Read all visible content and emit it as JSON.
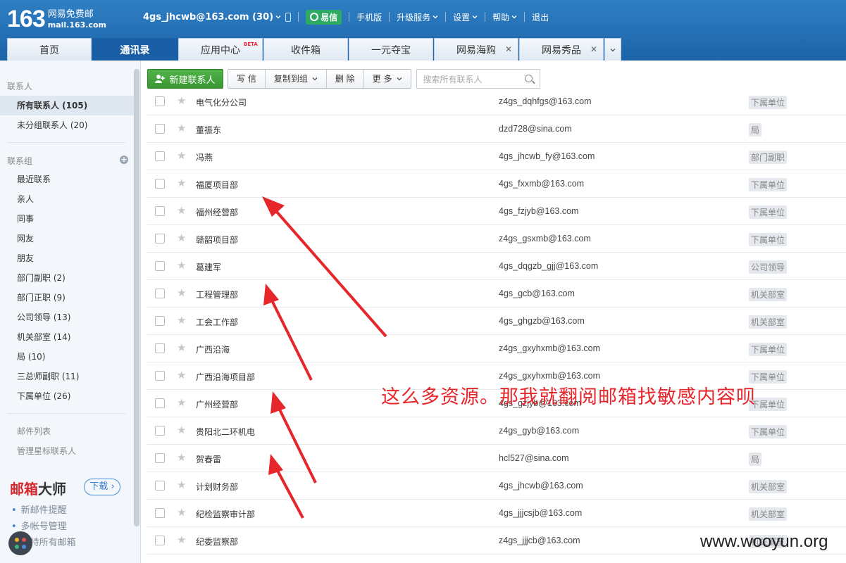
{
  "logo": {
    "number": "163",
    "line1": "网易免费邮",
    "line2": "mail.163.com"
  },
  "topbar": {
    "account": "4gs_jhcwb@163.com (30)",
    "yixin": "易信",
    "mobile": "手机版",
    "upgrade": "升级服务",
    "settings": "设置",
    "help": "帮助",
    "logout": "退出"
  },
  "tabs": [
    {
      "label": "首页"
    },
    {
      "label": "通讯录"
    },
    {
      "label": "应用中心",
      "badge": "BETA"
    },
    {
      "label": "收件箱"
    },
    {
      "label": "一元夺宝"
    },
    {
      "label": "网易海购"
    },
    {
      "label": "网易秀品"
    }
  ],
  "sidebar": {
    "contacts_head": "联系人",
    "all_contacts": "所有联系人 (105)",
    "ungrouped": "未分组联系人 (20)",
    "groups_head": "联系组",
    "groups": [
      "最近联系",
      "亲人",
      "同事",
      "网友",
      "朋友",
      "部门副职 (2)",
      "部门正职 (9)",
      "公司领导 (13)",
      "机关部室 (14)",
      "局 (10)",
      "三总师副职 (11)",
      "下属单位 (26)"
    ],
    "mail_list": "邮件列表",
    "manage_star": "管理星标联系人",
    "promo_title_red": "邮箱",
    "promo_title_dark": "大师",
    "download": "下载",
    "promo_items": [
      "新邮件提醒",
      "多帐号管理",
      "支持所有邮箱"
    ]
  },
  "toolbar": {
    "new_contact": "新建联系人",
    "write": "写 信",
    "copy_to_group": "复制到组",
    "delete": "删 除",
    "more": "更 多",
    "search_placeholder": "搜索所有联系人"
  },
  "contacts": [
    {
      "name": "电气化分公司",
      "email": "z4gs_dqhfgs@163.com",
      "tag": "下属单位"
    },
    {
      "name": "董振东",
      "email": "dzd728@sina.com",
      "tag": "局"
    },
    {
      "name": "冯燕",
      "email": "4gs_jhcwb_fy@163.com",
      "tag": "部门副职"
    },
    {
      "name": "福厦项目部",
      "email": "4gs_fxxmb@163.com",
      "tag": "下属单位"
    },
    {
      "name": "福州经营部",
      "email": "4gs_fzjyb@163.com",
      "tag": "下属单位"
    },
    {
      "name": "赣韶项目部",
      "email": "z4gs_gsxmb@163.com",
      "tag": "下属单位"
    },
    {
      "name": "葛建军",
      "email": "4gs_dqgzb_gjj@163.com",
      "tag": "公司领导"
    },
    {
      "name": "工程管理部",
      "email": "4gs_gcb@163.com",
      "tag": "机关部室"
    },
    {
      "name": "工会工作部",
      "email": "4gs_ghgzb@163.com",
      "tag": "机关部室"
    },
    {
      "name": "广西沿海",
      "email": "z4gs_gxyhxmb@163.com",
      "tag": "下属单位"
    },
    {
      "name": "广西沿海项目部",
      "email": "z4gs_gxyhxmb@163.com",
      "tag": "下属单位"
    },
    {
      "name": "广州经营部",
      "email": "4gs_gzjyb@163.com",
      "tag": "下属单位"
    },
    {
      "name": "贵阳北二环机电",
      "email": "z4gs_gyb@163.com",
      "tag": "下属单位"
    },
    {
      "name": "贺春雷",
      "email": "hcl527@sina.com",
      "tag": "局"
    },
    {
      "name": "计划财务部",
      "email": "4gs_jhcwb@163.com",
      "tag": "机关部室"
    },
    {
      "name": "纪检监察审计部",
      "email": "4gs_jjjcsjb@163.com",
      "tag": "机关部室"
    },
    {
      "name": "纪委监察部",
      "email": "z4gs_jjjcb@163.com",
      "tag": "机关部室"
    }
  ],
  "annotation": "这么多资源。那我就翻阅邮箱找敏感内容呗",
  "watermark": "www.wooyun.org"
}
